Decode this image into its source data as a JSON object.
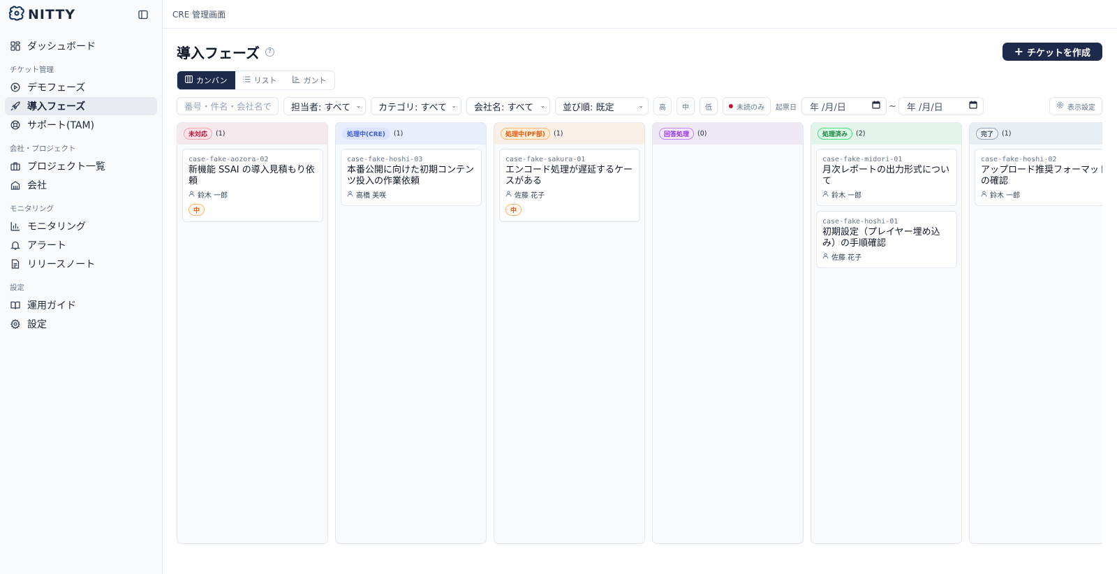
{
  "app": {
    "logo_text": "NITTY",
    "breadcrumb": "CRE 管理画面"
  },
  "sidebar": {
    "top_item": {
      "label": "ダッシュボード",
      "icon": "dashboard-icon"
    },
    "sections": [
      {
        "label": "チケット管理",
        "items": [
          {
            "label": "デモフェーズ",
            "icon": "play-circle-icon",
            "active": false
          },
          {
            "label": "導入フェーズ",
            "icon": "rocket-icon",
            "active": true
          },
          {
            "label": "サポート(TAM)",
            "icon": "lifebuoy-icon",
            "active": false
          }
        ]
      },
      {
        "label": "会社・プロジェクト",
        "items": [
          {
            "label": "プロジェクト一覧",
            "icon": "briefcase-icon",
            "active": false
          },
          {
            "label": "会社",
            "icon": "building-icon",
            "active": false
          }
        ]
      },
      {
        "label": "モニタリング",
        "items": [
          {
            "label": "モニタリング",
            "icon": "bar-chart-icon",
            "active": false
          },
          {
            "label": "アラート",
            "icon": "bell-icon",
            "active": false
          },
          {
            "label": "リリースノート",
            "icon": "file-text-icon",
            "active": false
          }
        ]
      },
      {
        "label": "設定",
        "items": [
          {
            "label": "運用ガイド",
            "icon": "book-icon",
            "active": false
          },
          {
            "label": "設定",
            "icon": "gear-icon",
            "active": false
          }
        ]
      }
    ]
  },
  "page": {
    "title": "導入フェーズ",
    "create_button": "チケットを作成",
    "view_tabs": {
      "kanban": "カンバン",
      "list": "リスト",
      "gantt": "ガント"
    },
    "filters": {
      "search_placeholder": "番号・件名・会社名で検索",
      "assignee": "担当者: すべて",
      "category": "カテゴリ: すべて",
      "company": "会社名: すべて",
      "sort": "並び順: 既定",
      "priority_high": "高",
      "priority_mid": "中",
      "priority_low": "低",
      "unread": "未読のみ",
      "date_label": "起票日",
      "date_placeholder": "年 /月/日",
      "tilde": "~",
      "display_settings": "表示設定"
    }
  },
  "colors": {
    "accent": "#1e2a4a",
    "unread_dot": "#be123c"
  },
  "board": {
    "columns": [
      {
        "label": "未対応",
        "count": "(1)",
        "header_bg": "#f6e9ee",
        "badge_color": "#be123c",
        "badge_bg": "#ffe4e6",
        "badge_border": "#fda4af",
        "cards": [
          {
            "id": "case-fake-aozora-02",
            "title": "新機能 SSAI の導入見積もり依頼",
            "assignee": "鈴木 一郎",
            "priority": "中"
          }
        ]
      },
      {
        "label": "処理中(CRE)",
        "count": "(1)",
        "header_bg": "#e8eefc",
        "badge_color": "#3b5bdb",
        "badge_bg": "#dbe4ff",
        "badge_border": "#dbe4ff",
        "cards": [
          {
            "id": "case-fake-hoshi-03",
            "title": "本番公開に向けた初期コンテンツ投入の作業依頼",
            "assignee": "高橋 美咲",
            "priority": ""
          }
        ]
      },
      {
        "label": "処理中(PF部)",
        "count": "(1)",
        "header_bg": "#f8efe6",
        "badge_color": "#ea580c",
        "badge_bg": "#ffedd5",
        "badge_border": "#fdba74",
        "cards": [
          {
            "id": "case-fake-sakura-01",
            "title": "エンコード処理が遅延するケースがある",
            "assignee": "佐藤 花子",
            "priority": "中"
          }
        ]
      },
      {
        "label": "回答処理",
        "count": "(0)",
        "header_bg": "#efe8f5",
        "badge_color": "#9333ea",
        "badge_bg": "#f3e8ff",
        "badge_border": "#c084fc",
        "cards": []
      },
      {
        "label": "処理済み",
        "count": "(2)",
        "header_bg": "#e3f5ea",
        "badge_color": "#15803d",
        "badge_bg": "#dcfce7",
        "badge_border": "#4ade80",
        "cards": [
          {
            "id": "case-fake-midori-01",
            "title": "月次レポートの出力形式について",
            "assignee": "鈴木 一郎",
            "priority": ""
          },
          {
            "id": "case-fake-hoshi-01",
            "title": "初期設定（プレイヤー埋め込み）の手順確認",
            "assignee": "佐藤 花子",
            "priority": ""
          }
        ]
      },
      {
        "label": "完了",
        "count": "(1)",
        "header_bg": "#e8eef2",
        "badge_color": "#475569",
        "badge_bg": "#f1f5f9",
        "badge_border": "#94a3b8",
        "cards": [
          {
            "id": "case-fake-hoshi-02",
            "title": "アップロード推奨フォーマットの確認",
            "assignee": "鈴木 一郎",
            "priority": ""
          }
        ]
      }
    ]
  }
}
